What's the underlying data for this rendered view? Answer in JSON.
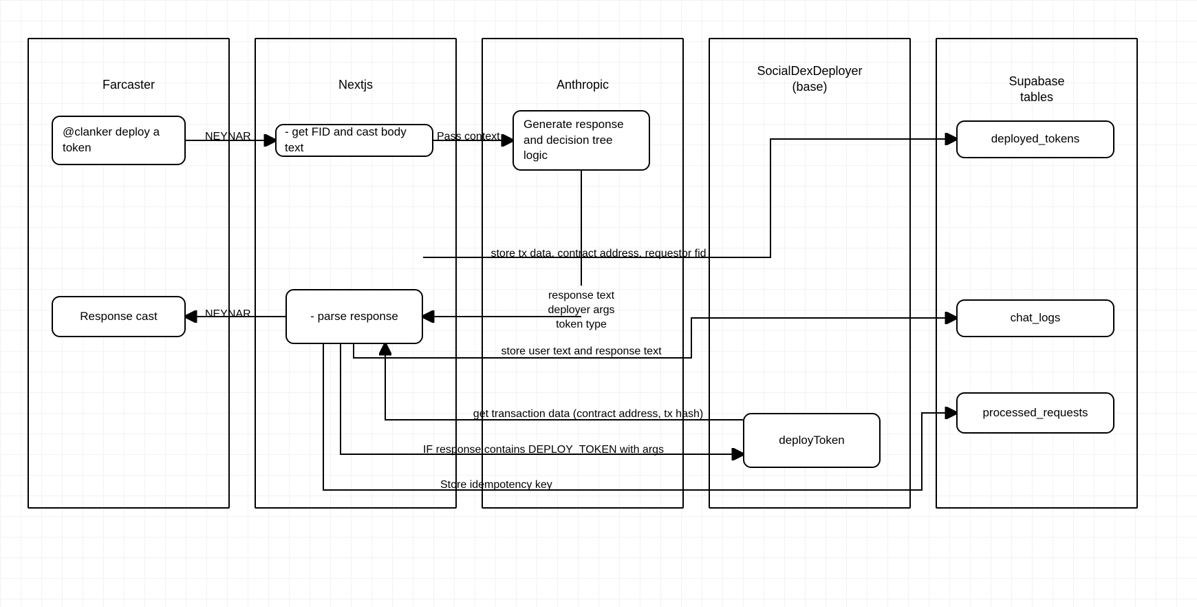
{
  "lanes": {
    "farcaster": "Farcaster",
    "nextjs": "Nextjs",
    "anthropic": "Anthropic",
    "socialdex": "SocialDexDeployer\n(base)",
    "supabase": "Supabase\ntables"
  },
  "nodes": {
    "clanker": "@clanker deploy a token",
    "get_fid": "- get FID and cast body text",
    "gen_response": "Generate response and decision tree logic",
    "response_cast": "Response cast",
    "parse_response": "- parse response",
    "deploy_token": "deployToken",
    "deployed_tokens": "deployed_tokens",
    "chat_logs": "chat_logs",
    "processed_requests": "processed_requests"
  },
  "edges": {
    "neynar1": "NEYNAR",
    "pass_context": "Pass context",
    "neynar2": "NEYNAR",
    "store_tx": "store tx data, contract address, requestor fid",
    "resp_block": "response text\ndeployer args\ntoken type",
    "store_user": "store user text and response text",
    "get_tx": "get transaction data (contract address, tx hash)",
    "if_deploy": "IF response contains DEPLOY_TOKEN with args",
    "store_idem": "Store idempotency key"
  }
}
